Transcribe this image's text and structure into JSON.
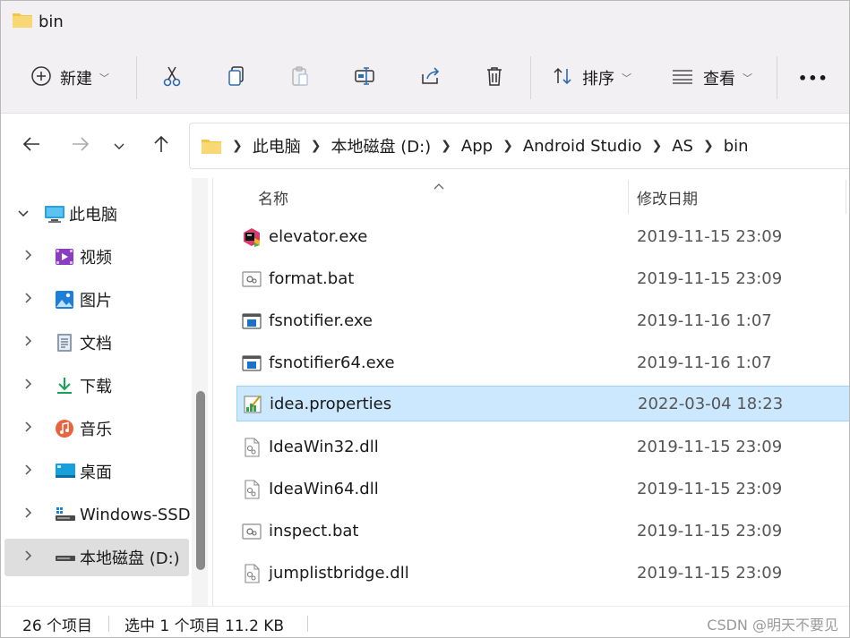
{
  "window": {
    "title": "bin"
  },
  "toolbar": {
    "new_label": "新建",
    "sort_label": "排序",
    "view_label": "查看",
    "more_label": "•••"
  },
  "address": {
    "crumbs": [
      "此电脑",
      "本地磁盘 (D:)",
      "App",
      "Android Studio",
      "AS",
      "bin"
    ]
  },
  "sidebar": {
    "items": [
      {
        "label": "此电脑",
        "icon": "computer-icon"
      },
      {
        "label": "视频",
        "icon": "video-folder-icon"
      },
      {
        "label": "图片",
        "icon": "pictures-folder-icon"
      },
      {
        "label": "文档",
        "icon": "documents-folder-icon"
      },
      {
        "label": "下载",
        "icon": "download-folder-icon"
      },
      {
        "label": "音乐",
        "icon": "music-folder-icon"
      },
      {
        "label": "桌面",
        "icon": "desktop-folder-icon"
      },
      {
        "label": "Windows-SSD",
        "icon": "drive-icon"
      },
      {
        "label": "本地磁盘 (D:)",
        "icon": "drive-icon"
      }
    ]
  },
  "columns": {
    "name": "名称",
    "modified": "修改日期"
  },
  "files": [
    {
      "name": "elevator.exe",
      "date": "2019-11-15 23:09",
      "icon": "exe-app-icon"
    },
    {
      "name": "format.bat",
      "date": "2019-11-15 23:09",
      "icon": "batch-file-icon"
    },
    {
      "name": "fsnotifier.exe",
      "date": "2019-11-16 1:07",
      "icon": "exe-window-icon"
    },
    {
      "name": "fsnotifier64.exe",
      "date": "2019-11-16 1:07",
      "icon": "exe-window-icon"
    },
    {
      "name": "idea.properties",
      "date": "2022-03-04 18:23",
      "icon": "properties-file-icon",
      "selected": true
    },
    {
      "name": "IdeaWin32.dll",
      "date": "2019-11-15 23:09",
      "icon": "dll-file-icon"
    },
    {
      "name": "IdeaWin64.dll",
      "date": "2019-11-15 23:09",
      "icon": "dll-file-icon"
    },
    {
      "name": "inspect.bat",
      "date": "2019-11-15 23:09",
      "icon": "batch-file-icon"
    },
    {
      "name": "jumplistbridge.dll",
      "date": "2019-11-15 23:09",
      "icon": "dll-file-icon"
    }
  ],
  "status": {
    "item_count": "26 个项目",
    "selection": "选中 1 个项目  11.2 KB"
  },
  "watermark": "CSDN @明天不要见",
  "colors": {
    "selection_bg": "#cce8ff",
    "selection_border": "#99d1ff",
    "folder": "#f4c542"
  }
}
